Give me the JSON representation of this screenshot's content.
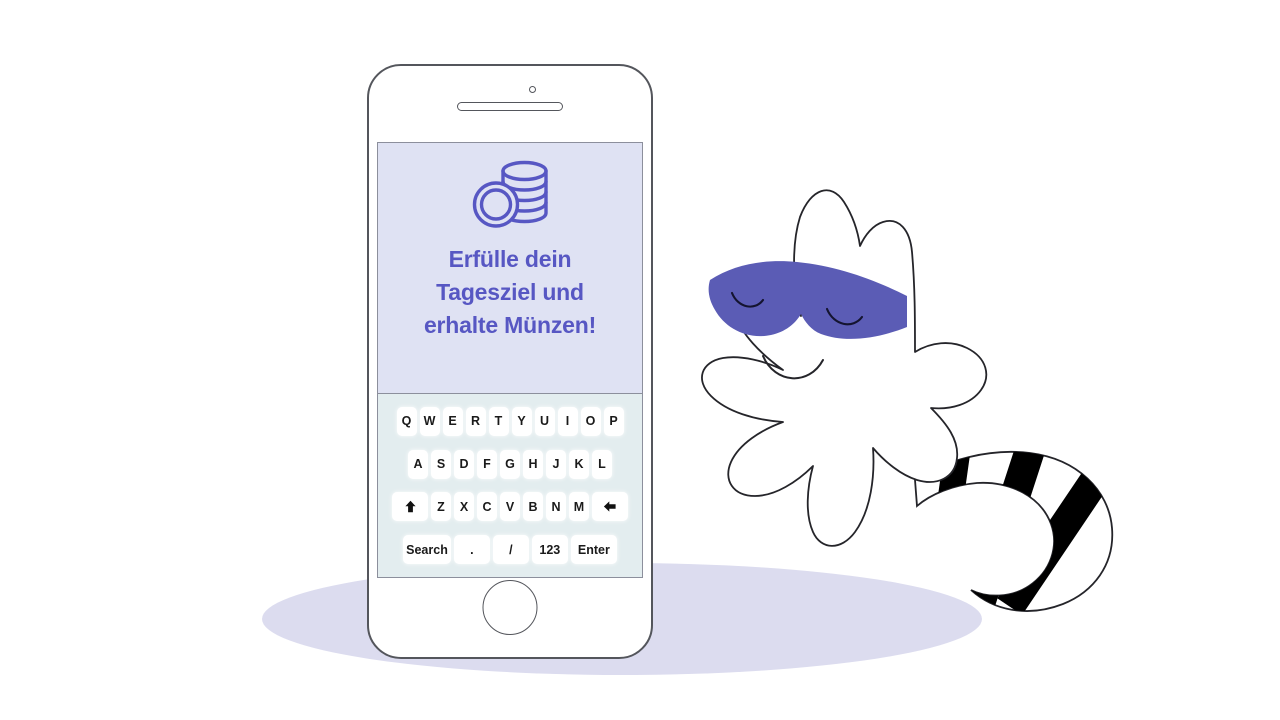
{
  "scene": {
    "background_color": "#ffffff",
    "shadow_color": "#dcdcef"
  },
  "phone": {
    "frame_color": "#54565c",
    "body_color": "#ffffff",
    "camera_label": "camera",
    "speaker_label": "earpiece-speaker",
    "home_button_label": "Home"
  },
  "screen": {
    "background_color": "#dfe2f3",
    "border_color": "#8c8f9c",
    "promo": {
      "icon_name": "coin-stack-icon",
      "icon_color": "#5757c3",
      "headline_lines": [
        "Erfülle dein",
        "Tagesziel und",
        "erhalte  Münzen!"
      ],
      "headline_full": "Erfülle dein Tagesziel und erhalte Münzen!",
      "text_color": "#5757c3"
    },
    "keyboard": {
      "background_color": "#e3edef",
      "key_color": "#ffffff",
      "key_text_color": "#1a1a1a",
      "row1": [
        "Q",
        "W",
        "E",
        "R",
        "T",
        "Y",
        "U",
        "I",
        "O",
        "P"
      ],
      "row2": [
        "A",
        "S",
        "D",
        "F",
        "G",
        "H",
        "J",
        "K",
        "L"
      ],
      "row3": [
        {
          "label": "",
          "icon": "shift-arrow-up-icon",
          "type": "shift"
        },
        {
          "label": "Z",
          "icon": "",
          "type": "letter"
        },
        {
          "label": "X",
          "icon": "",
          "type": "letter"
        },
        {
          "label": "C",
          "icon": "",
          "type": "letter"
        },
        {
          "label": "V",
          "icon": "",
          "type": "letter"
        },
        {
          "label": "B",
          "icon": "",
          "type": "letter"
        },
        {
          "label": "N",
          "icon": "",
          "type": "letter"
        },
        {
          "label": "M",
          "icon": "",
          "type": "letter"
        },
        {
          "label": "",
          "icon": "backspace-arrow-left-icon",
          "type": "backspace"
        }
      ],
      "row4": [
        {
          "label": "Search",
          "type": "search"
        },
        {
          "label": ".",
          "type": "period"
        },
        {
          "label": "/",
          "type": "slash"
        },
        {
          "label": "123",
          "type": "numeric"
        },
        {
          "label": "Enter",
          "type": "enter"
        }
      ]
    }
  },
  "mascot": {
    "name": "raccoon-blob-mascot",
    "body_color": "#ffffff",
    "outline_color": "#25252a",
    "mask_color": "#5b5cb5",
    "tail_stripe_color": "#000000",
    "expression": "closed-eyes-smile",
    "tail_stripe_count": 3
  }
}
